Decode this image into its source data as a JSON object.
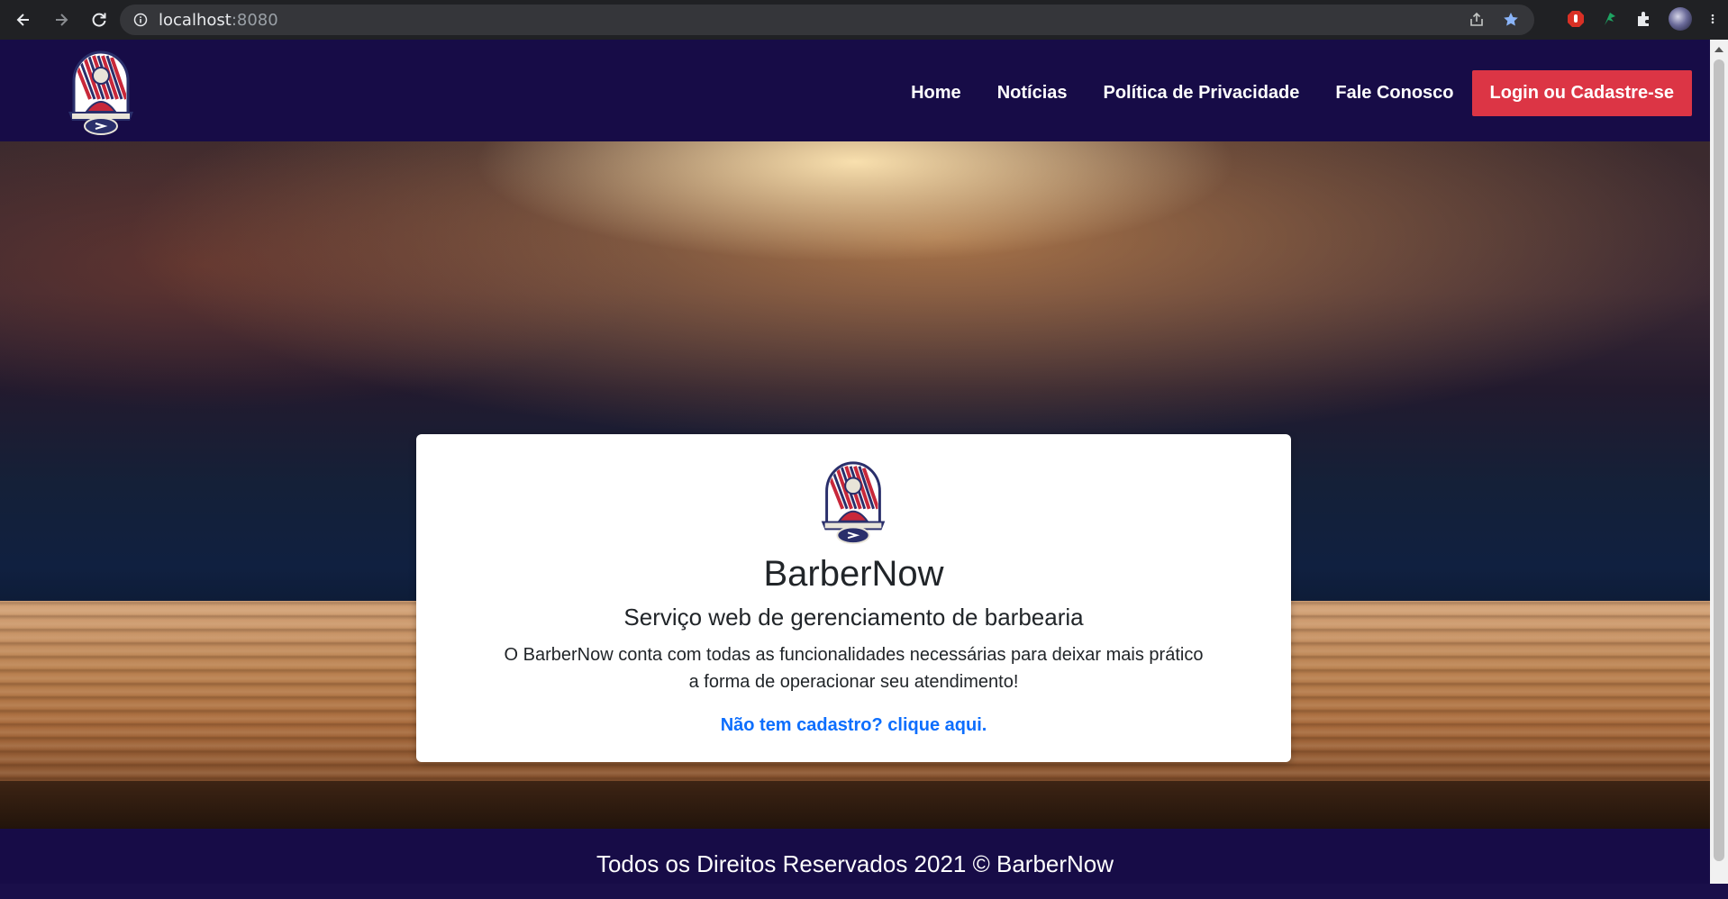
{
  "browser": {
    "url_host": "localhost",
    "url_port": ":8080"
  },
  "navbar": {
    "links": [
      {
        "label": "Home"
      },
      {
        "label": "Notícias"
      },
      {
        "label": "Política de Privacidade"
      },
      {
        "label": "Fale Conosco"
      }
    ],
    "login_label": "Login ou Cadastre-se",
    "login_color": "#dc3545",
    "background_color": "#170c47"
  },
  "card": {
    "title": "BarberNow",
    "subtitle": "Serviço web de gerenciamento de barbearia",
    "description": "O BarberNow conta com todas as funcionalidades necessárias para deixar mais prático a forma de operacionar seu atendimento!",
    "link_label": "Não tem cadastro? clique aqui.",
    "link_color": "#0d6efd"
  },
  "footer": {
    "text": "Todos os Direitos Reservados 2021 © BarberNow"
  },
  "icons": {
    "logo": "barber-logo-icon"
  }
}
